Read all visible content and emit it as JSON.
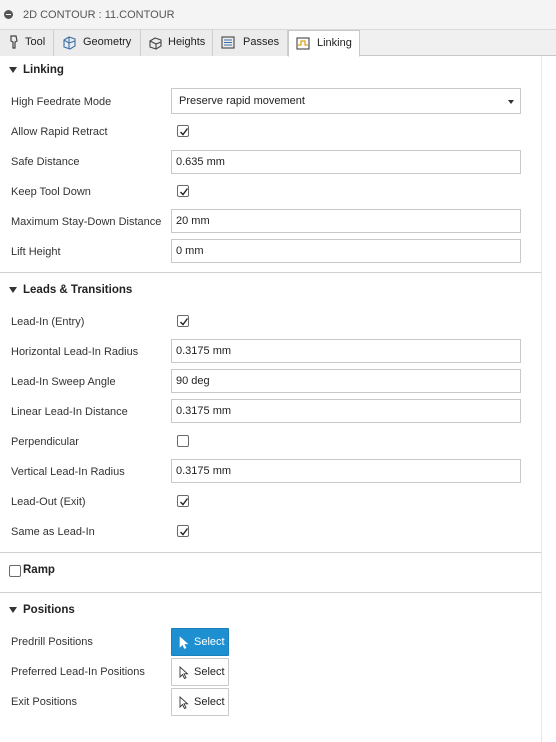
{
  "window": {
    "title": "2D CONTOUR : 11.CONTOUR"
  },
  "tabs": [
    {
      "label": "Tool",
      "icon": "tool-icon"
    },
    {
      "label": "Geometry",
      "icon": "geometry-icon"
    },
    {
      "label": "Heights",
      "icon": "heights-icon"
    },
    {
      "label": "Passes",
      "icon": "passes-icon"
    },
    {
      "label": "Linking",
      "icon": "linking-icon",
      "active": true
    }
  ],
  "linking": {
    "heading": "Linking",
    "high_feedrate_mode": {
      "label": "High Feedrate Mode",
      "value": "Preserve rapid movement"
    },
    "allow_rapid_retract": {
      "label": "Allow Rapid Retract",
      "checked": true
    },
    "safe_distance": {
      "label": "Safe Distance",
      "value": "0.635 mm"
    },
    "keep_tool_down": {
      "label": "Keep Tool Down",
      "checked": true
    },
    "max_stay_down": {
      "label": "Maximum Stay-Down Distance",
      "value": "20 mm"
    },
    "lift_height": {
      "label": "Lift Height",
      "value": "0 mm"
    }
  },
  "leads": {
    "heading": "Leads & Transitions",
    "lead_in": {
      "label": "Lead-In (Entry)",
      "checked": true
    },
    "horizontal_lead_in_radius": {
      "label": "Horizontal Lead-In Radius",
      "value": "0.3175 mm"
    },
    "lead_in_sweep_angle": {
      "label": "Lead-In Sweep Angle",
      "value": "90 deg"
    },
    "linear_lead_in_distance": {
      "label": "Linear Lead-In Distance",
      "value": "0.3175 mm"
    },
    "perpendicular": {
      "label": "Perpendicular",
      "checked": false
    },
    "vertical_lead_in_radius": {
      "label": "Vertical Lead-In Radius",
      "value": "0.3175 mm"
    },
    "lead_out": {
      "label": "Lead-Out (Exit)",
      "checked": true
    },
    "same_as_lead_in": {
      "label": "Same as Lead-In",
      "checked": true
    }
  },
  "ramp": {
    "heading": "Ramp",
    "checked": false
  },
  "positions": {
    "heading": "Positions",
    "predrill": {
      "label": "Predrill Positions",
      "button": "Select",
      "active": true
    },
    "preferred_lead_in": {
      "label": "Preferred Lead-In Positions",
      "button": "Select",
      "active": false
    },
    "exit": {
      "label": "Exit Positions",
      "button": "Select",
      "active": false
    }
  },
  "colors": {
    "accent": "#1e90d2",
    "border": "#c9c9c9"
  }
}
